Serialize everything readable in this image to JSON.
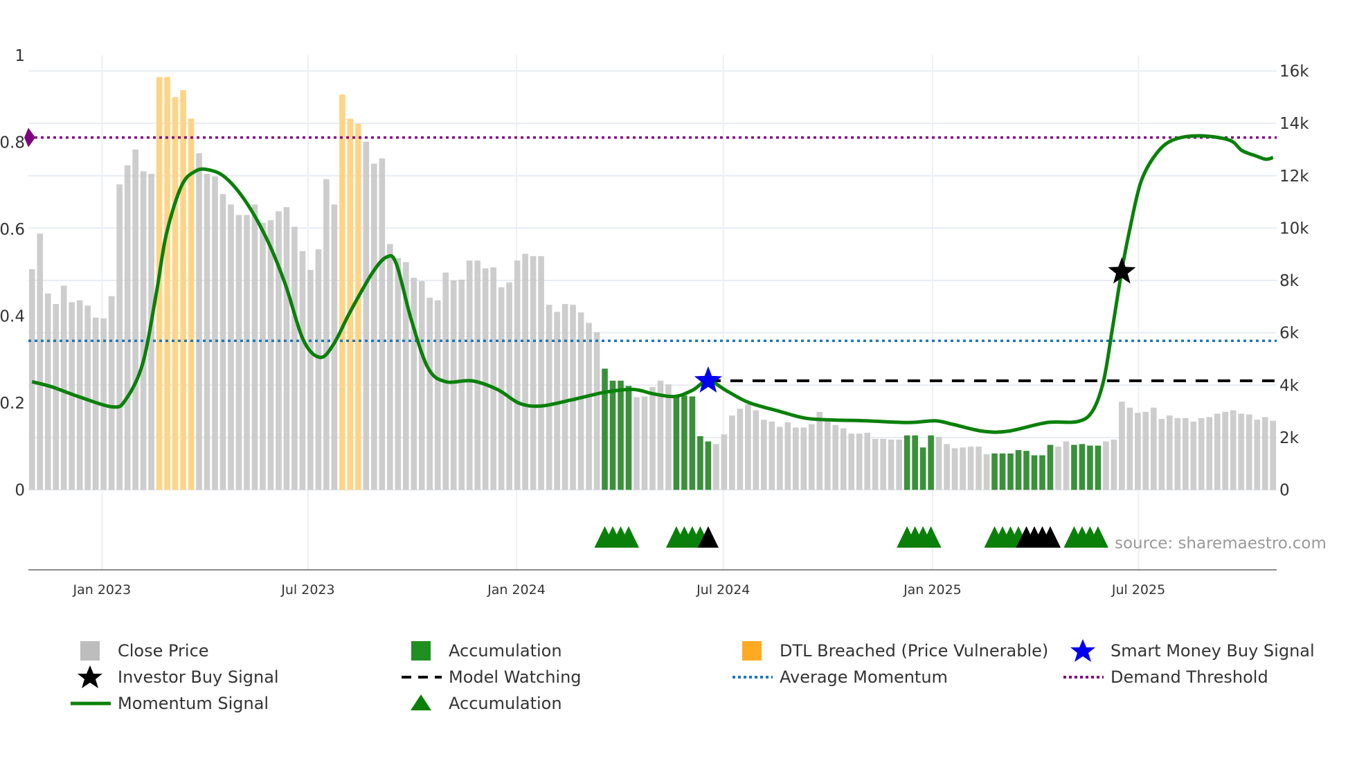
{
  "chart_data": {
    "type": "bar",
    "title": "",
    "left_axis": {
      "range": [
        0,
        1
      ],
      "ticks": [
        "0",
        "0.2",
        "0.4",
        "0.6",
        "0.8",
        "1"
      ],
      "tick_values": [
        0,
        0.2,
        0.4,
        0.6,
        0.8,
        1
      ]
    },
    "right_axis": {
      "range_k": [
        0,
        16
      ],
      "ticks": [
        "0",
        "2k",
        "4k",
        "6k",
        "8k",
        "10k",
        "12k",
        "14k",
        "16k"
      ],
      "tick_values": [
        0,
        2,
        4,
        6,
        8,
        10,
        12,
        14,
        16
      ]
    },
    "x_ticks": [
      "Jan 2023",
      "Jul 2023",
      "Jan 2024",
      "Jul 2024",
      "Jan 2025",
      "Jul 2025"
    ],
    "x_tick_bar_index": [
      9.8,
      35.7,
      61.9,
      87.9,
      114.2,
      140.1
    ],
    "bars_price_k": [
      8.43,
      9.79,
      7.5,
      7.1,
      7.8,
      7.17,
      7.24,
      7.04,
      6.58,
      6.55,
      7.4,
      11.67,
      12.4,
      13.0,
      12.17,
      12.07,
      15.77,
      15.77,
      15.0,
      15.27,
      14.18,
      12.86,
      12.07,
      11.97,
      11.3,
      10.9,
      10.5,
      10.5,
      10.9,
      10.2,
      10.3,
      10.64,
      10.8,
      10.05,
      9.12,
      8.4,
      9.19,
      11.87,
      10.9,
      15.1,
      14.18,
      13.98,
      13.3,
      12.46,
      12.66,
      9.39,
      8.86,
      8.7,
      8.1,
      7.97,
      7.34,
      7.24,
      8.3,
      8.0,
      8.03,
      8.76,
      8.76,
      8.46,
      8.5,
      7.74,
      7.93,
      8.76,
      9.02,
      8.93,
      8.93,
      7.07,
      6.8,
      7.1,
      7.07,
      6.78,
      6.38,
      6.02,
      4.63,
      4.17,
      4.17,
      3.97,
      3.54,
      3.57,
      3.93,
      4.17,
      4.03,
      3.6,
      3.6,
      3.57,
      2.05,
      1.85,
      1.75,
      2.12,
      2.84,
      3.1,
      3.27,
      3.04,
      2.68,
      2.61,
      2.41,
      2.58,
      2.38,
      2.38,
      2.51,
      2.98,
      2.68,
      2.48,
      2.35,
      2.15,
      2.15,
      2.18,
      1.95,
      1.95,
      1.92,
      1.92,
      2.08,
      2.08,
      1.62,
      2.08,
      2.02,
      1.75,
      1.59,
      1.62,
      1.65,
      1.65,
      1.36,
      1.39,
      1.39,
      1.39,
      1.52,
      1.49,
      1.32,
      1.32,
      1.72,
      1.65,
      1.85,
      1.72,
      1.75,
      1.69,
      1.69,
      1.85,
      1.92,
      3.37,
      3.14,
      2.94,
      2.98,
      3.14,
      2.71,
      2.84,
      2.74,
      2.74,
      2.61,
      2.74,
      2.78,
      2.91,
      2.98,
      3.04,
      2.91,
      2.88,
      2.68,
      2.78,
      2.64
    ],
    "dtl_breached_bars": [
      17,
      18,
      19,
      20,
      21,
      40,
      41,
      42
    ],
    "accumulation_bars": [
      73,
      74,
      75,
      76,
      82,
      83,
      84,
      85,
      86,
      111,
      112,
      113,
      114,
      122,
      123,
      124,
      125,
      126,
      127,
      128,
      129,
      132,
      133,
      134,
      135
    ],
    "accumulation_triangles_green": [
      73,
      74,
      75,
      76,
      82,
      83,
      84,
      85,
      111,
      112,
      113,
      114,
      122,
      123,
      124,
      125,
      132,
      133,
      134,
      135
    ],
    "accumulation_triangles_black": [
      86,
      126,
      127,
      128,
      129
    ],
    "momentum_signal": {
      "x": [
        1,
        3.5,
        6.8,
        11.1,
        12.75,
        14.9,
        16.6,
        17.9,
        19.8,
        21.5,
        23.1,
        25.3,
        28,
        30.7,
        32.9,
        35.1,
        37.2,
        38.9,
        41,
        43.8,
        45.6,
        46.8,
        48.7,
        50.8,
        53,
        56.3,
        59.5,
        62.3,
        65,
        68.8,
        73.1,
        76.6,
        79.1,
        81.8,
        84,
        86,
        88.4,
        91.1,
        94.9,
        98.2,
        101.4,
        105.8,
        111.2,
        114.5,
        116.7,
        120.5,
        123.7,
        128.6,
        132.4,
        134.3,
        135.7,
        136.8,
        138,
        139,
        140.4,
        142.3,
        144.4,
        147.7,
        151.5,
        153.1,
        154.8,
        156.1,
        157
      ],
      "y": [
        0.249,
        0.237,
        0.215,
        0.191,
        0.207,
        0.29,
        0.45,
        0.59,
        0.7,
        0.733,
        0.737,
        0.719,
        0.66,
        0.57,
        0.47,
        0.345,
        0.305,
        0.335,
        0.41,
        0.5,
        0.536,
        0.52,
        0.39,
        0.28,
        0.249,
        0.251,
        0.231,
        0.199,
        0.193,
        0.207,
        0.225,
        0.231,
        0.221,
        0.215,
        0.229,
        0.251,
        0.227,
        0.201,
        0.181,
        0.165,
        0.161,
        0.159,
        0.155,
        0.159,
        0.151,
        0.135,
        0.135,
        0.155,
        0.157,
        0.181,
        0.251,
        0.37,
        0.506,
        0.6,
        0.709,
        0.773,
        0.805,
        0.815,
        0.805,
        0.781,
        0.769,
        0.761,
        0.765
      ]
    },
    "demand_threshold": 0.811,
    "average_momentum": 0.343,
    "model_watching": {
      "value": 0.251,
      "from_bar": 86
    },
    "smart_money_buy_signal": {
      "bar": 86,
      "value": 0.251
    },
    "investor_buy_signal": {
      "bar": 138,
      "value": 0.502
    },
    "colors": {
      "close": "#c8c8c8",
      "accumulation": "#2e8b2e",
      "dtl": "#ffd27f",
      "momentum": "#0a800a",
      "demand": "#800080",
      "average": "#1f77b4",
      "smart": "#0000ee",
      "investor": "#000000"
    },
    "legend": [
      "Close Price",
      "Accumulation",
      "DTL Breached (Price Vulnerable)",
      "Smart Money Buy Signal",
      "Investor Buy Signal",
      "Model Watching",
      "Average Momentum",
      "Demand Threshold",
      "Momentum Signal",
      "Accumulation"
    ],
    "legend_placement": "bottom",
    "source": "source: sharemaestro.com"
  }
}
